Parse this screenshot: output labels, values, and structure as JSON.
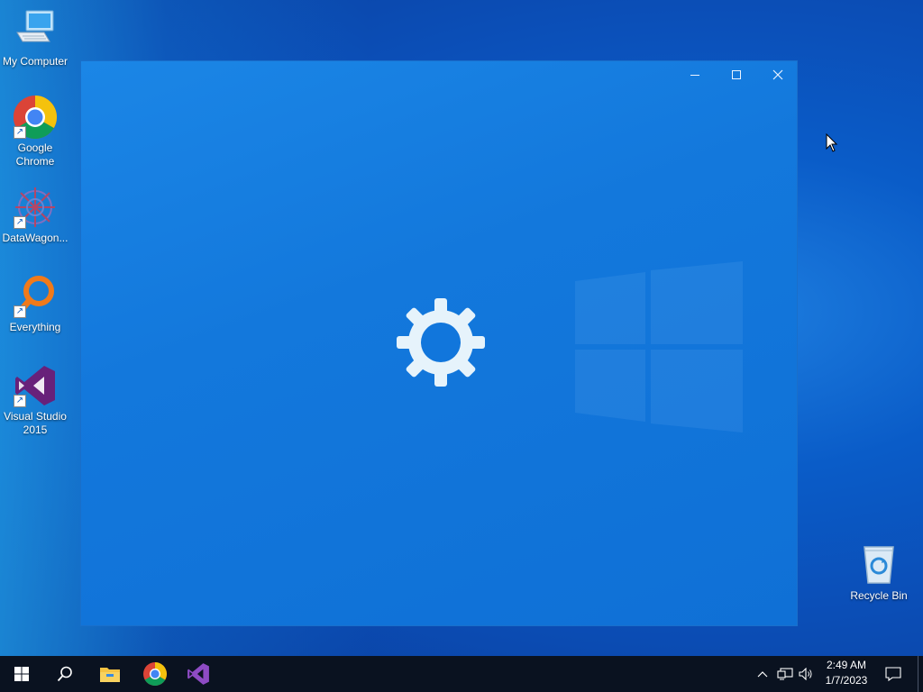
{
  "desktop": {
    "icons": [
      {
        "label": "My Computer",
        "icon": "computer-icon"
      },
      {
        "label": "Google Chrome",
        "icon": "chrome-icon",
        "shortcut": true
      },
      {
        "label": "DataWagon...",
        "icon": "datawagon-icon",
        "shortcut": true
      },
      {
        "label": "Everything",
        "icon": "everything-search-icon",
        "shortcut": true
      },
      {
        "label": "Visual Studio 2015",
        "icon": "visual-studio-icon",
        "shortcut": true
      },
      {
        "label": "Recycle Bin",
        "icon": "recycle-bin-icon"
      }
    ]
  },
  "window": {
    "state": "loading",
    "center_icon": "gear-icon",
    "controls": [
      "minimize-icon",
      "maximize-icon",
      "close-icon"
    ]
  },
  "taskbar": {
    "pinned": [
      "start-icon",
      "search-icon",
      "file-explorer-icon",
      "chrome-icon",
      "visual-studio-icon"
    ],
    "tray_icons": [
      "chevron-up-icon",
      "network-icon",
      "volume-icon",
      "notification-icon"
    ],
    "clock": {
      "time": "2:49 AM",
      "date": "1/7/2023"
    }
  },
  "colors": {
    "accent": "#0f70d6",
    "taskbar": "#0a1220",
    "gear": "#e6f3fb"
  }
}
